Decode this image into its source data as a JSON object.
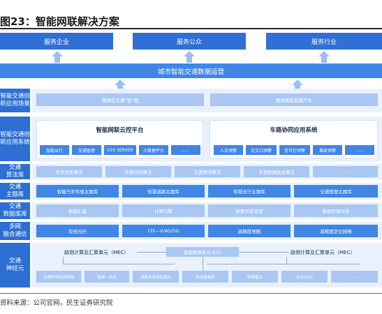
{
  "title": "图23：智能网联解决方案",
  "top_services": [
    "服务企业",
    "服务公众",
    "服务行业"
  ],
  "platform": "城市智能交通数据运营",
  "innovation_scene": {
    "label": "智能交通创\n新应用场景",
    "items": [
      "精细化交通“管”理",
      "数据赋能智能汽车"
    ]
  },
  "innovation_system": {
    "label": "智能交通创\n新应用系统",
    "left_title": "智能网联云控平台",
    "left_items": [
      "智能出行",
      "交通管理",
      "V2X SERVER",
      "大数据平台",
      "......"
    ],
    "right_title": "车路协同应用系统",
    "right_items": [
      "人车预警",
      "交叉口预警",
      "信号灯预警",
      "事故预警",
      "......"
    ]
  },
  "algorithm": {
    "label": "交通\n算法库",
    "items": [
      "信号优化算法",
      "车路协同算法",
      "交通预测算法",
      "多源数据融合算法",
      "......"
    ]
  },
  "topic": {
    "label": "交通\n主题库",
    "items": [
      "智能汽车传感主题库",
      "智慧道路主题库",
      "智慧出行主题库",
      "交通管理主题库"
    ]
  },
  "database": {
    "label": "交通\n数据底库",
    "items": [
      "数据汇集",
      "计算引擎",
      "数据开发治理",
      "数据开放共享"
    ]
  },
  "network": {
    "label": "多网\n融合通信",
    "items": [
      "有线光纤",
      "LTE—V/4G/5G",
      "高精度地图",
      "高精度定位网络"
    ]
  },
  "nerve": {
    "label": "交通\n神经元",
    "mec_left": "路侧计算及汇聚单元（MEC）",
    "rsu": "智能路侧单元 RSU",
    "mec_right": "路侧计算及汇聚单元（MEC）",
    "items": [
      "交通时间检测终端",
      "雷视一体机",
      "道路业务感知基站",
      "热成像相机",
      "频谱雷达",
      "北斗/GPS",
      "......"
    ]
  },
  "source": "资料来源：公司官网，民生证券研究院",
  "colors": {
    "dark_blue": "#2d6fd3",
    "mid_blue": "#3f86e6",
    "light_cell": "#a9c7f2",
    "band": "#e9f1fc"
  }
}
